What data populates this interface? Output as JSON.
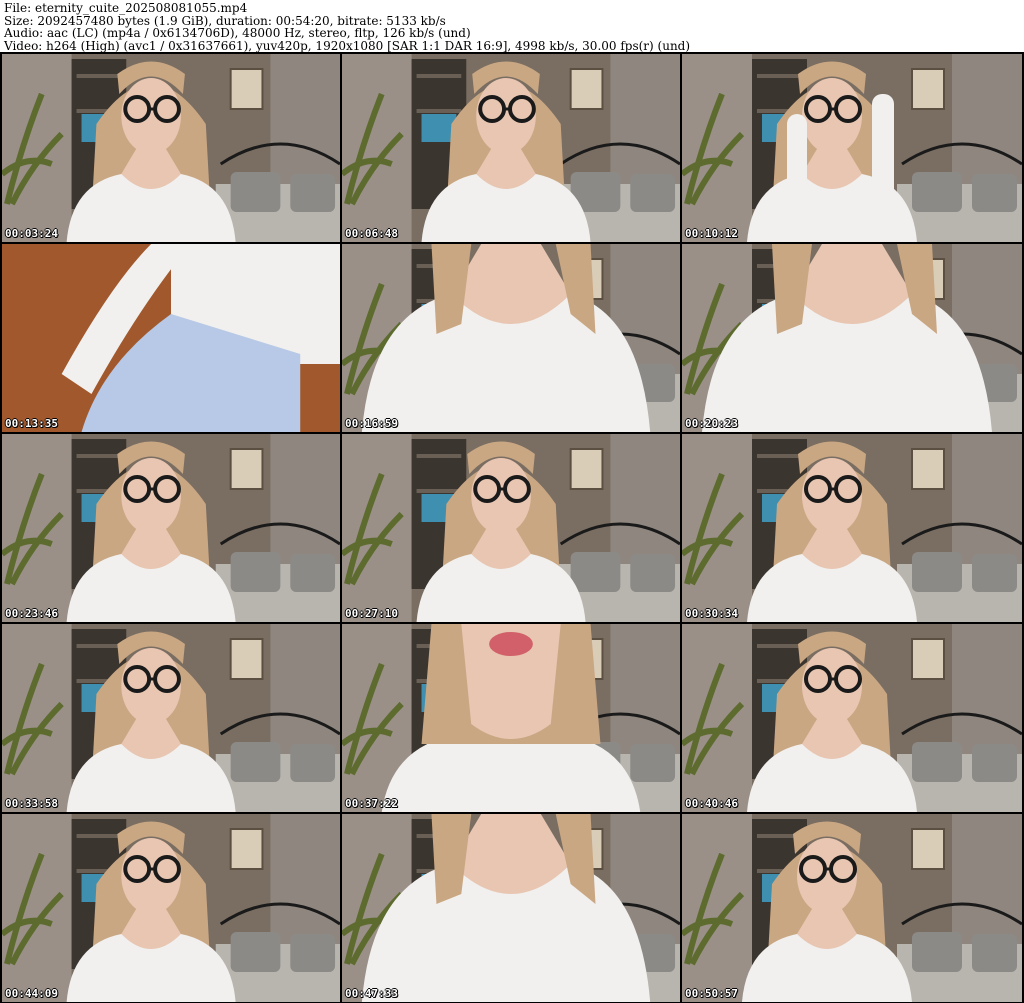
{
  "file_info": {
    "file": "File: eternity_cuite_202508081055.mp4",
    "size": "Size: 2092457480 bytes (1.9 GiB), duration: 00:54:20, bitrate: 5133 kb/s",
    "audio": "Audio: aac (LC) (mp4a / 0x6134706D), 48000 Hz, stereo, fltp, 126 kb/s (und)",
    "video": "Video: h264 (High) (avc1 / 0x31637661), yuv420p, 1920x1080 [SAR 1:1 DAR 16:9], 4998 kb/s, 30.00 fps(r) (und)"
  },
  "thumbnails": [
    {
      "time": "00:03:24",
      "scene": "face-glasses"
    },
    {
      "time": "00:06:48",
      "scene": "face-glasses"
    },
    {
      "time": "00:10:12",
      "scene": "face-glasses-hands"
    },
    {
      "time": "00:13:35",
      "scene": "closeup-shorts"
    },
    {
      "time": "00:16:59",
      "scene": "closeup-torso"
    },
    {
      "time": "00:20:23",
      "scene": "closeup-torso"
    },
    {
      "time": "00:23:46",
      "scene": "face-glasses"
    },
    {
      "time": "00:27:10",
      "scene": "face-glasses"
    },
    {
      "time": "00:30:34",
      "scene": "face-glasses"
    },
    {
      "time": "00:33:58",
      "scene": "face-glasses"
    },
    {
      "time": "00:37:22",
      "scene": "closeup-mouth"
    },
    {
      "time": "00:40:46",
      "scene": "face-glasses"
    },
    {
      "time": "00:44:09",
      "scene": "face-glasses"
    },
    {
      "time": "00:47:33",
      "scene": "closeup-torso"
    },
    {
      "time": "00:50:57",
      "scene": "face-glasses"
    }
  ],
  "colors": {
    "wall": "#7a6e62",
    "curtain": "#9a9088",
    "shelf": "#3b3530",
    "plant": "#5d6b2f",
    "bed": "#b8b4ae",
    "pillow": "#8c8a86",
    "hair": "#caa783",
    "skin": "#e8c6b2",
    "shirt": "#f1f0ee",
    "shorts": "#b7c9e6",
    "floor": "#a0582c",
    "glasses": "#1a1a1a"
  }
}
